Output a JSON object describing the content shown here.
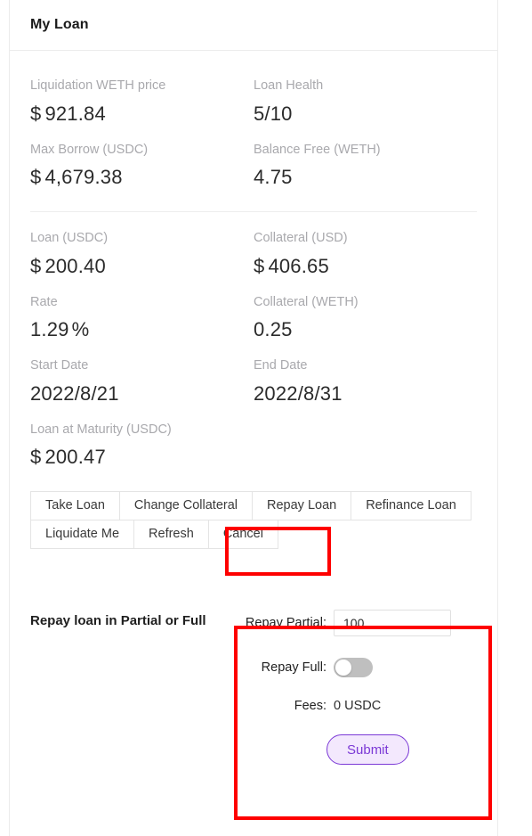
{
  "card": {
    "title": "My Loan"
  },
  "stats": {
    "group_a": [
      {
        "label": "Liquidation WETH price",
        "currency": "$",
        "value": "921.84"
      },
      {
        "label": "Loan Health",
        "currency": "",
        "value": "5/10"
      },
      {
        "label": "Max Borrow (USDC)",
        "currency": "$",
        "value": "4,679.38"
      },
      {
        "label": "Balance Free (WETH)",
        "currency": "",
        "value": "4.75"
      }
    ],
    "group_b": [
      {
        "label": "Loan (USDC)",
        "currency": "$",
        "value": "200.40"
      },
      {
        "label": "Collateral (USD)",
        "currency": "$",
        "value": "406.65"
      },
      {
        "label": "Rate",
        "currency": "",
        "value": "1.29",
        "suffix": "%"
      },
      {
        "label": "Collateral (WETH)",
        "currency": "",
        "value": "0.25"
      },
      {
        "label": "Start Date",
        "currency": "",
        "value": "2022/8/21"
      },
      {
        "label": "End Date",
        "currency": "",
        "value": "2022/8/31"
      },
      {
        "label": "Loan at Maturity (USDC)",
        "currency": "$",
        "value": "200.47"
      }
    ]
  },
  "actions": {
    "row1": [
      {
        "label": "Take Loan",
        "selected": false
      },
      {
        "label": "Change Collateral",
        "selected": false
      },
      {
        "label": "Repay Loan",
        "selected": true
      },
      {
        "label": "Refinance Loan",
        "selected": false
      }
    ],
    "row2": [
      {
        "label": "Liquidate Me",
        "selected": false
      },
      {
        "label": "Refresh",
        "selected": false
      },
      {
        "label": "Cancel",
        "selected": false
      }
    ]
  },
  "repay_form": {
    "heading": "Repay loan in Partial or Full",
    "partial_label": "Repay Partial:",
    "partial_value": "100",
    "partial_placeholder": "",
    "full_label": "Repay Full:",
    "full_enabled": false,
    "fees_label": "Fees:",
    "fees_value": "0 USDC",
    "submit_label": "Submit"
  },
  "colors": {
    "annotation": "#fe0000",
    "submit_border": "#7b39d6",
    "submit_background": "#f3e8fd",
    "label_gray": "#a9a9ad",
    "card_border": "#ececec"
  }
}
